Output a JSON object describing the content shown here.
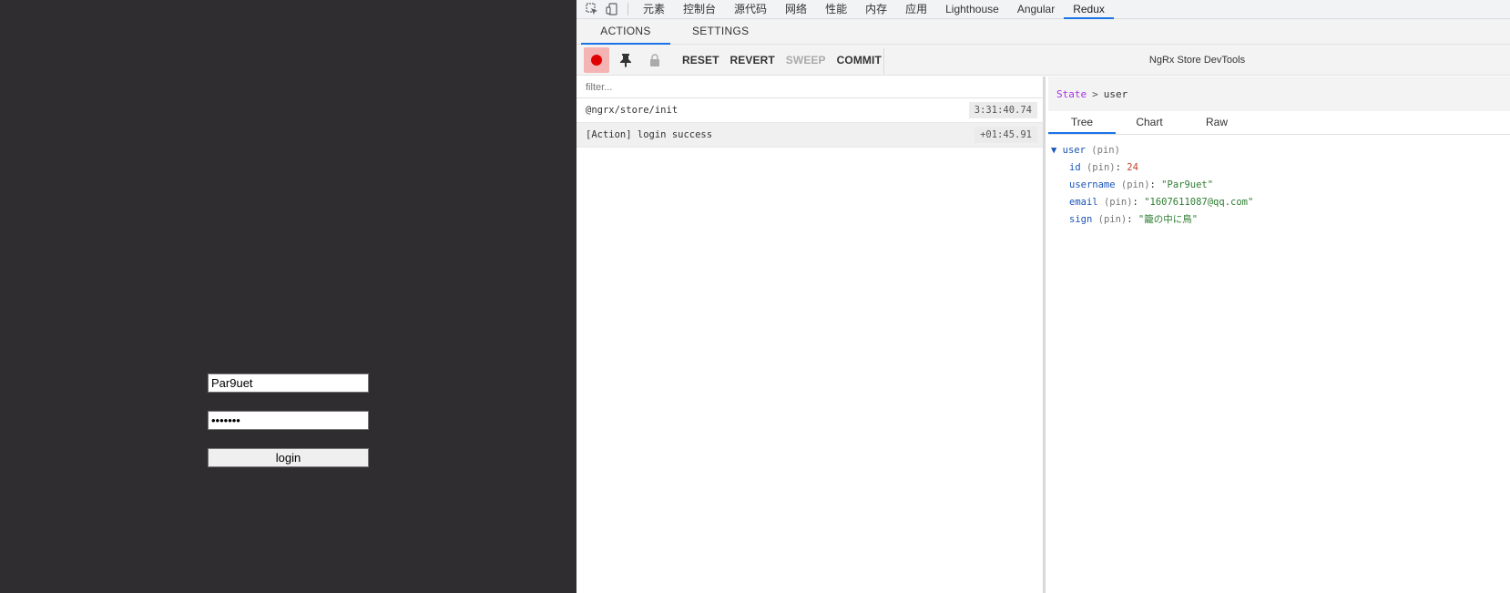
{
  "app": {
    "username_value": "Par9uet",
    "password_value": "•••••••",
    "login_label": "login"
  },
  "devtools": {
    "panel_tabs": [
      "元素",
      "控制台",
      "源代码",
      "网络",
      "性能",
      "内存",
      "应用",
      "Lighthouse",
      "Angular",
      "Redux"
    ],
    "active_panel": "Redux",
    "icons": [
      "inspect-element-icon",
      "device-toggle-icon"
    ],
    "redux_tabs": [
      "ACTIONS",
      "SETTINGS"
    ],
    "toolbar": {
      "reset": "RESET",
      "revert": "REVERT",
      "sweep": "SWEEP",
      "commit": "COMMIT",
      "title": "NgRx Store DevTools"
    },
    "filter_placeholder": "filter...",
    "actions": [
      {
        "type": "@ngrx/store/init",
        "time": "3:31:40.74"
      },
      {
        "type": "[Action] login success",
        "time": "+01:45.91"
      }
    ],
    "state": {
      "breadcrumb_root": "State",
      "breadcrumb_sep": ">",
      "breadcrumb_current": "user",
      "tabs": [
        "Tree",
        "Chart",
        "Raw"
      ],
      "tree": {
        "root_key": "user",
        "pin": "(pin)",
        "colon": ":",
        "arrow": "▼",
        "fields": [
          {
            "key": "id",
            "value": "24",
            "kind": "number"
          },
          {
            "key": "username",
            "value": "\"Par9uet\"",
            "kind": "string"
          },
          {
            "key": "email",
            "value": "\"1607611087@qq.com\"",
            "kind": "string"
          },
          {
            "key": "sign",
            "value": "\"籠の中に鳥\"",
            "kind": "string"
          }
        ]
      }
    },
    "colors": {
      "accent": "#1a73e8",
      "record": "#e00000",
      "app_bg": "#302d30"
    }
  }
}
